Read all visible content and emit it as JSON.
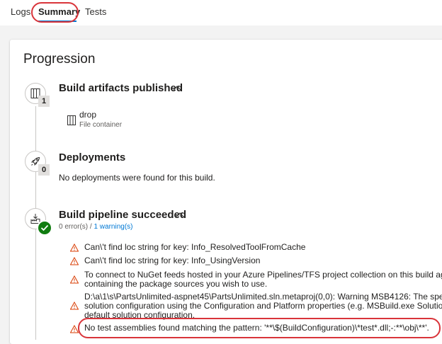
{
  "tabs": {
    "logs": "Logs",
    "summary": "Summary",
    "tests": "Tests"
  },
  "page": {
    "title": "Progression"
  },
  "artifacts": {
    "title": "Build artifacts published",
    "count": "1",
    "item_name": "drop",
    "item_type": "File container"
  },
  "deployments": {
    "title": "Deployments",
    "count": "0",
    "message": "No deployments were found for this build."
  },
  "pipeline": {
    "title": "Build pipeline succeeded",
    "errors": "0 error(s)",
    "separator": " / ",
    "warnings": "1 warning(s)",
    "messages": [
      "Can\\'t find loc string for key: Info_ResolvedToolFromCache",
      "Can\\'t find loc string for key: Info_UsingVersion",
      "To connect to NuGet feeds hosted in your Azure Pipelines/TFS project collection on this build ag",
      "containing the package sources you wish to use.",
      "D:\\a\\1\\s\\PartsUnlimited-aspnet45\\PartsUnlimited.sln.metaproj(0,0): Warning MSB4126: The spec",
      "solution configuration using the Configuration and Platform properties (e.g. MSBuild.exe Solutio",
      "default solution configuration.",
      "No test assemblies found matching the pattern: '**\\$(BuildConfiguration)\\*test*.dll;-:**\\obj\\**'."
    ]
  },
  "colors": {
    "accent": "#0078d4",
    "success": "#107c10",
    "warning": "#d83b01",
    "highlight": "#d9343a"
  },
  "icons": {
    "artifact": "artifact-icon",
    "deployment": "rocket-icon",
    "pipeline": "build-pipeline-icon",
    "warning": "warning-triangle-icon",
    "chevron": "chevron-up-icon"
  }
}
